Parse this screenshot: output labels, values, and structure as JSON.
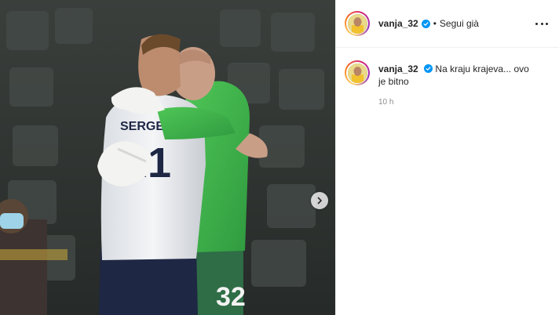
{
  "post": {
    "media": {
      "jersey_name": "SERGEJ",
      "jersey_number": "21",
      "shorts_number": "32",
      "next_icon": "chevron-right-icon"
    },
    "header": {
      "username": "vanja_32",
      "separator": "•",
      "follow_state": "Segui già",
      "more_icon": "more-horizontal-icon"
    },
    "caption": {
      "username": "vanja_32",
      "text": "Na kraju krajeva... ovo je bitno",
      "timestamp": "10 h"
    },
    "colors": {
      "verified": "#0095f6",
      "secondary_text": "#8e8e8e",
      "keeper_green": "#3bb54a"
    }
  }
}
